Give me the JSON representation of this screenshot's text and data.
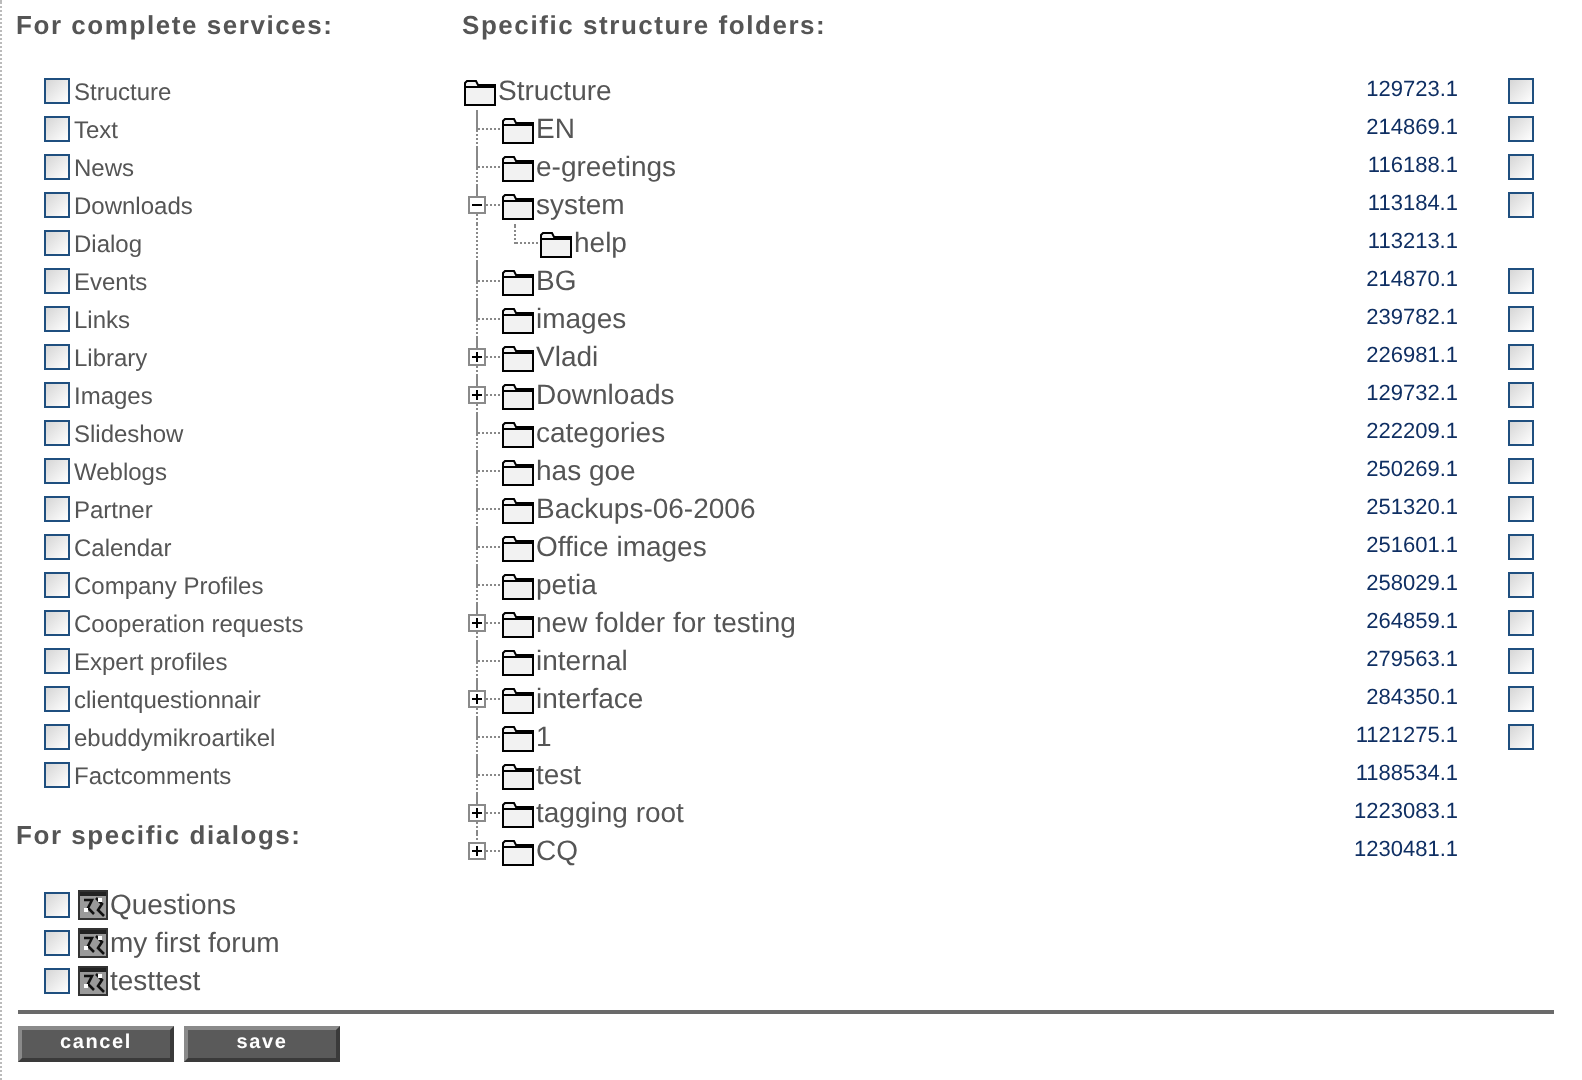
{
  "services": {
    "heading": "For complete services:",
    "items": [
      {
        "label": "Structure",
        "checked": false
      },
      {
        "label": "Text",
        "checked": false
      },
      {
        "label": "News",
        "checked": false
      },
      {
        "label": "Downloads",
        "checked": false
      },
      {
        "label": "Dialog",
        "checked": false
      },
      {
        "label": "Events",
        "checked": false
      },
      {
        "label": "Links",
        "checked": false
      },
      {
        "label": "Library",
        "checked": false
      },
      {
        "label": "Images",
        "checked": false
      },
      {
        "label": "Slideshow",
        "checked": false
      },
      {
        "label": "Weblogs",
        "checked": false
      },
      {
        "label": "Partner",
        "checked": false
      },
      {
        "label": "Calendar",
        "checked": false
      },
      {
        "label": "Company Profiles",
        "checked": false
      },
      {
        "label": "Cooperation requests",
        "checked": false
      },
      {
        "label": "Expert profiles",
        "checked": false
      },
      {
        "label": "clientquestionnair",
        "checked": false
      },
      {
        "label": "ebuddymikroartikel",
        "checked": false
      },
      {
        "label": "Factcomments",
        "checked": false
      }
    ]
  },
  "dialogs": {
    "heading": "For specific dialogs:",
    "items": [
      {
        "label": "Questions",
        "checked": false
      },
      {
        "label": "my first forum",
        "checked": false
      },
      {
        "label": "testtest",
        "checked": false
      }
    ]
  },
  "folders": {
    "heading": "Specific structure folders:",
    "tree": {
      "label": "Structure",
      "id": "129723.1",
      "checked": false,
      "children": [
        {
          "label": "EN",
          "id": "214869.1",
          "checked": false
        },
        {
          "label": "e-greetings",
          "id": "116188.1",
          "checked": false
        },
        {
          "label": "system",
          "id": "113184.1",
          "checked": false,
          "expanded": true,
          "children": [
            {
              "label": "help",
              "id": "113213.1"
            }
          ]
        },
        {
          "label": "BG",
          "id": "214870.1",
          "checked": false
        },
        {
          "label": "images",
          "id": "239782.1",
          "checked": false
        },
        {
          "label": "Vladi",
          "id": "226981.1",
          "checked": false,
          "expanded": false
        },
        {
          "label": "Downloads",
          "id": "129732.1",
          "checked": false,
          "expanded": false
        },
        {
          "label": "categories",
          "id": "222209.1",
          "checked": false
        },
        {
          "label": "has goe",
          "id": "250269.1",
          "checked": false
        },
        {
          "label": "Backups-06-2006",
          "id": "251320.1",
          "checked": false
        },
        {
          "label": "Office images",
          "id": "251601.1",
          "checked": false
        },
        {
          "label": "petia",
          "id": "258029.1",
          "checked": false
        },
        {
          "label": "new folder for testing",
          "id": "264859.1",
          "checked": false,
          "expanded": false
        },
        {
          "label": "internal",
          "id": "279563.1",
          "checked": false
        },
        {
          "label": "interface",
          "id": "284350.1",
          "checked": false,
          "expanded": false
        },
        {
          "label": "1",
          "id": "1121275.1",
          "checked": false
        },
        {
          "label": "test",
          "id": "1188534.1"
        },
        {
          "label": "tagging root",
          "id": "1223083.1",
          "expanded": false
        },
        {
          "label": "CQ",
          "id": "1230481.1",
          "expanded": false
        }
      ]
    }
  },
  "buttons": [
    {
      "label": "cancel"
    },
    {
      "label": "save"
    }
  ]
}
